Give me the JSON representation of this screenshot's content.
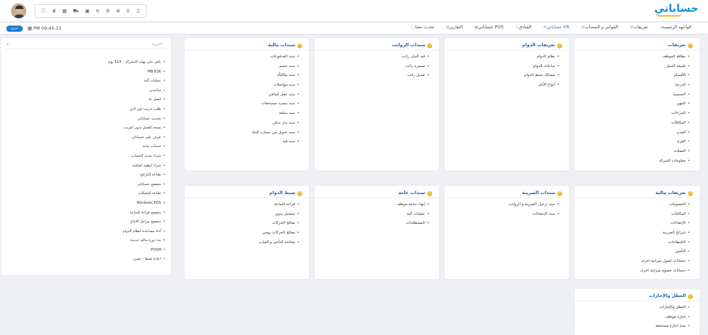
{
  "app": {
    "logo": "حساباتي"
  },
  "header": {
    "icons": [
      "info-icon",
      "medal-icon",
      "calculator-icon",
      "cart-icon",
      "bus-icon",
      "database-icon",
      "gear-icon",
      "close-circle-icon",
      "link-icon",
      "notifications-icon"
    ],
    "icon_glyphs": [
      "ⓘ",
      "♛",
      "▦",
      "⛟",
      "▣",
      "≋",
      "⚙",
      "⊗",
      "⚲",
      "♫"
    ]
  },
  "nav": {
    "items": [
      {
        "label": "الواجهة الرئيسية",
        "icon": "⌂"
      },
      {
        "label": "تعريفات",
        "icon": "⚙"
      },
      {
        "label": "الفواتير و السندات",
        "icon": "☰"
      },
      {
        "label": "حساباتي HR",
        "icon": "⚙"
      },
      {
        "label": "الفنادق",
        "icon": "☖"
      },
      {
        "label": "حساباتي POS",
        "icon": "▦"
      },
      {
        "label": "التقارير",
        "icon": "▤"
      },
      {
        "label": "تحدث معنا",
        "icon": "◯"
      }
    ],
    "active_index": 3,
    "clock": "PM 09:45:15",
    "lang_button": "عربي"
  },
  "cards": [
    {
      "title": "تعريفات",
      "items": [
        "بطاقة الموظف",
        "طبيعة العمل",
        "الأقسام",
        "الدرجة",
        "الجنسية",
        "المهن",
        "الجزاءات",
        "المكافآت",
        "المدن",
        "القرى",
        "العملات",
        "معلومات الشركة"
      ]
    },
    {
      "title": "تعريفات الدوام",
      "items": [
        "نظام الدوام",
        "ساعات الدوام",
        "مسالك ضبط الدوام",
        "أنواع الأيام"
      ]
    },
    {
      "title": "سندات الرواتب",
      "items": [
        "قيد البيان راتب",
        "مسيرة راتب",
        "تعديل راتب"
      ]
    },
    {
      "title": "سندات مالية",
      "items": [
        "سند المدفوعات",
        "سند خصم",
        "سند مكافأة",
        "سند مواصلات",
        "سند عمل إضافي",
        "سند تسديد مستحقات",
        "سند سلفة",
        "سند بدل سكن",
        "سند تحويل من حساب البنك",
        "سند قيد"
      ]
    },
    {
      "title": "تعريفات مالية",
      "items": [
        "الخصومات",
        "المكافآت",
        "الإعفاءات",
        "شرائح الضريبة",
        "الاقتطاعات",
        "التأمين",
        "حسابات اصول ميزانية اخرى",
        "حسابات خصوم ميزانية اخرى"
      ]
    },
    {
      "title": "سندات الضريبة",
      "items": [
        "سند ترحيل الضريبة و الرواتب",
        "سند الإعفاءات"
      ]
    },
    {
      "title": "سندات عامة",
      "items": [
        "إنهاء خدمة موظف",
        "عمليات آلية",
        "المصطلحات"
      ]
    },
    {
      "title": "ضبط الدوام",
      "items": [
        "قراءة الساعة",
        "تسجيل يدوي",
        "معالج الحركات",
        "معالج الحركات يومي",
        "معالجة التأخير و الغياب"
      ]
    },
    {
      "title": "العطل والإجازات",
      "items": [
        "العطل والإجازات",
        "إجازة موظف",
        "سند اجازة مستحقة"
      ]
    }
  ],
  "side": {
    "placeholder": "الفروع",
    "items": [
      "باقي على نهاية الاشتراك : 514 يوم",
      "MB 836",
      "عمليات آلية",
      "ساعدني",
      "اتصل بنا",
      "طلب تدريب اون لاين",
      "تحديث حساباتي",
      "نسخة للعمل بدون انترنت",
      "تعرف على حساباتي",
      "خدمات عامة",
      "شراء تمديد الحساب",
      "شراء انظمة اضافية",
      "طباعة الباركود",
      "متصفح حساباتي",
      "طباعة الشيكات",
      "Windows POS",
      "متصفح قراءة الساعة",
      "متصفح مراحل الانتاج",
      "أداة مساعدة لنظام الدوام",
      "بدء دورة مالية جديدة",
      "POSM",
      "اعادة ضبط - تعيين"
    ]
  }
}
